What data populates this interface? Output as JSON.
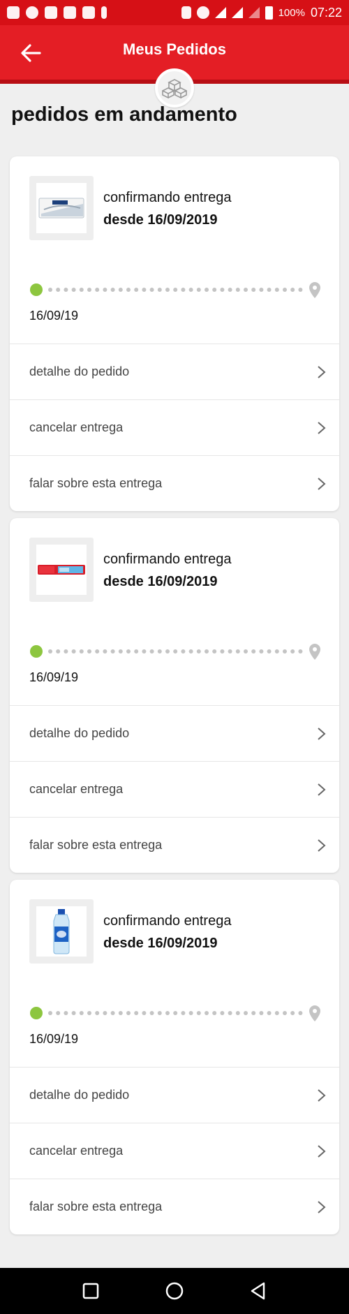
{
  "status_bar": {
    "battery": "100%",
    "time": "07:22"
  },
  "header": {
    "title": "Meus Pedidos",
    "back_icon": "arrow-left-icon",
    "badge_icon": "boxes-icon"
  },
  "section": {
    "title": "pedidos em andamento"
  },
  "orders": [
    {
      "product_icon": "soap-bar-icon",
      "status": "confirmando entrega",
      "since": "desde 16/09/2019",
      "tracking_date": "16/09/19",
      "actions": [
        {
          "label": "detalhe do pedido"
        },
        {
          "label": "cancelar entrega"
        },
        {
          "label": "falar sobre esta entrega"
        }
      ]
    },
    {
      "product_icon": "toothpaste-icon",
      "status": "confirmando entrega",
      "since": "desde 16/09/2019",
      "tracking_date": "16/09/19",
      "actions": [
        {
          "label": "detalhe do pedido"
        },
        {
          "label": "cancelar entrega"
        },
        {
          "label": "falar sobre esta entrega"
        }
      ]
    },
    {
      "product_icon": "detergent-bottle-icon",
      "status": "confirmando entrega",
      "since": "desde 16/09/2019",
      "tracking_date": "16/09/19",
      "actions": [
        {
          "label": "detalhe do pedido"
        },
        {
          "label": "cancelar entrega"
        },
        {
          "label": "falar sobre esta entrega"
        }
      ]
    }
  ],
  "colors": {
    "brand_red": "#e41e25",
    "progress_green": "#8dc63f",
    "dots_gray": "#c4c4c4"
  }
}
